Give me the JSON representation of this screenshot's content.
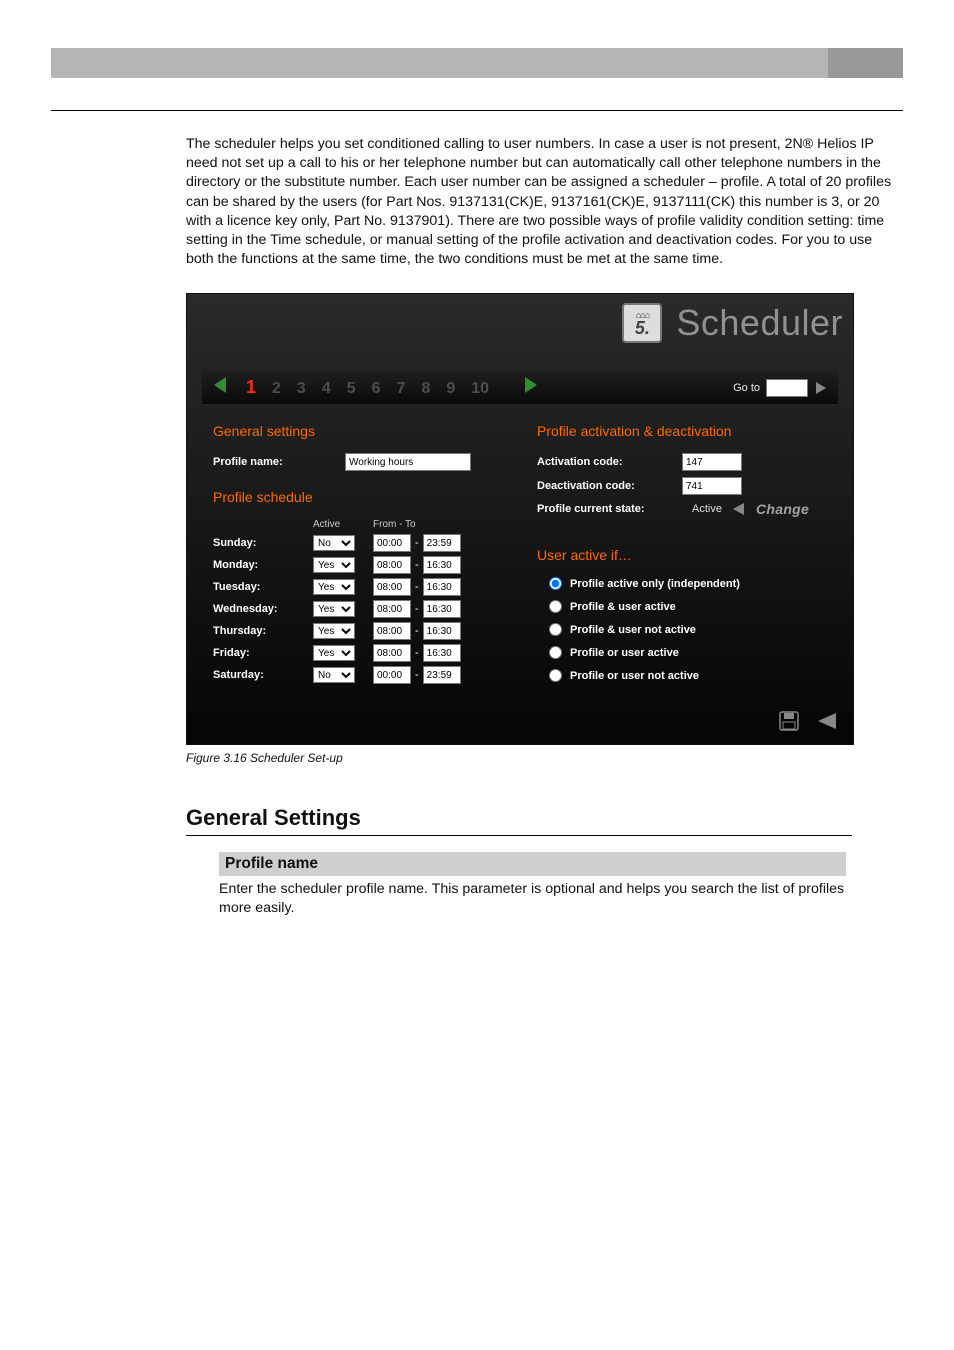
{
  "intro": "The scheduler helps you set conditioned calling to user numbers. In case a user is not present, 2N® Helios IP need not set up a call to his or her telephone number but can automatically call other telephone numbers in the directory or the substitute number. Each user number can be assigned a scheduler – profile. A total of 20 profiles can be shared by the users (for Part Nos. 9137131(CK)E, 9137161(CK)E, 9137111(CK) this number is 3, or 20 with a licence key only, Part No. 9137901). There are two possible ways of profile validity condition setting: time setting in the Time schedule, or manual setting of the profile activation and deactivation codes. For you to use both the functions at the same time, the two conditions must be met at the same time.",
  "shot": {
    "title": "Scheduler",
    "logo_num": "5.",
    "pager": {
      "pages": [
        "1",
        "2",
        "3",
        "4",
        "5",
        "6",
        "7",
        "8",
        "9",
        "10"
      ],
      "current": 0,
      "goto_label": "Go to",
      "goto_value": ""
    },
    "general": {
      "heading": "General settings",
      "profile_name_label": "Profile name:",
      "profile_name_value": "Working hours"
    },
    "schedule": {
      "heading": "Profile schedule",
      "col_active": "Active",
      "col_fromto": "From - To",
      "rows": [
        {
          "day": "Sunday:",
          "active": "No",
          "from": "00:00",
          "to": "23:59"
        },
        {
          "day": "Monday:",
          "active": "Yes",
          "from": "08:00",
          "to": "16:30"
        },
        {
          "day": "Tuesday:",
          "active": "Yes",
          "from": "08:00",
          "to": "16:30"
        },
        {
          "day": "Wednesday:",
          "active": "Yes",
          "from": "08:00",
          "to": "16:30"
        },
        {
          "day": "Thursday:",
          "active": "Yes",
          "from": "08:00",
          "to": "16:30"
        },
        {
          "day": "Friday:",
          "active": "Yes",
          "from": "08:00",
          "to": "16:30"
        },
        {
          "day": "Saturday:",
          "active": "No",
          "from": "00:00",
          "to": "23:59"
        }
      ]
    },
    "activation": {
      "heading": "Profile activation & deactivation",
      "act_label": "Activation code:",
      "act_value": "147",
      "deact_label": "Deactivation code:",
      "deact_value": "741",
      "state_label": "Profile current state:",
      "state_value": "Active",
      "change_label": "Change"
    },
    "user_active": {
      "heading": "User active if…",
      "options": [
        "Profile active only (independent)",
        "Profile & user active",
        "Profile & user not active",
        "Profile or user active",
        "Profile or user not active"
      ],
      "selected": 0
    }
  },
  "fig_caption": "Figure 3.16   Scheduler Set-up",
  "doc": {
    "h2": "General Settings",
    "h3": "Profile name",
    "body": "Enter the scheduler profile name. This parameter is optional and helps you search the list of profiles more easily."
  }
}
